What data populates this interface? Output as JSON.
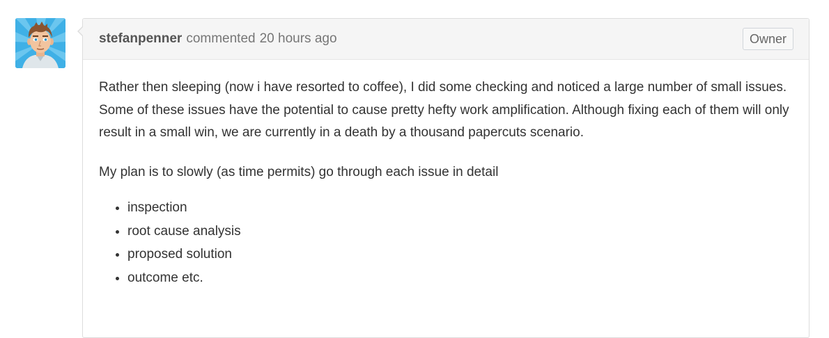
{
  "comment": {
    "author": "stefanpenner",
    "action": "commented",
    "timestamp": "20 hours ago",
    "badge": "Owner",
    "paragraphs": [
      "Rather then sleeping (now i have resorted to coffee), I did some checking and noticed a large number of small issues. Some of these issues have the potential to cause pretty hefty work amplification. Although fixing each of them will only result in a small win, we are currently in a death by a thousand papercuts scenario.",
      "My plan is to slowly (as time permits) go through each issue in detail"
    ],
    "list_items": [
      "inspection",
      "root cause analysis",
      "proposed solution",
      "outcome etc."
    ]
  }
}
